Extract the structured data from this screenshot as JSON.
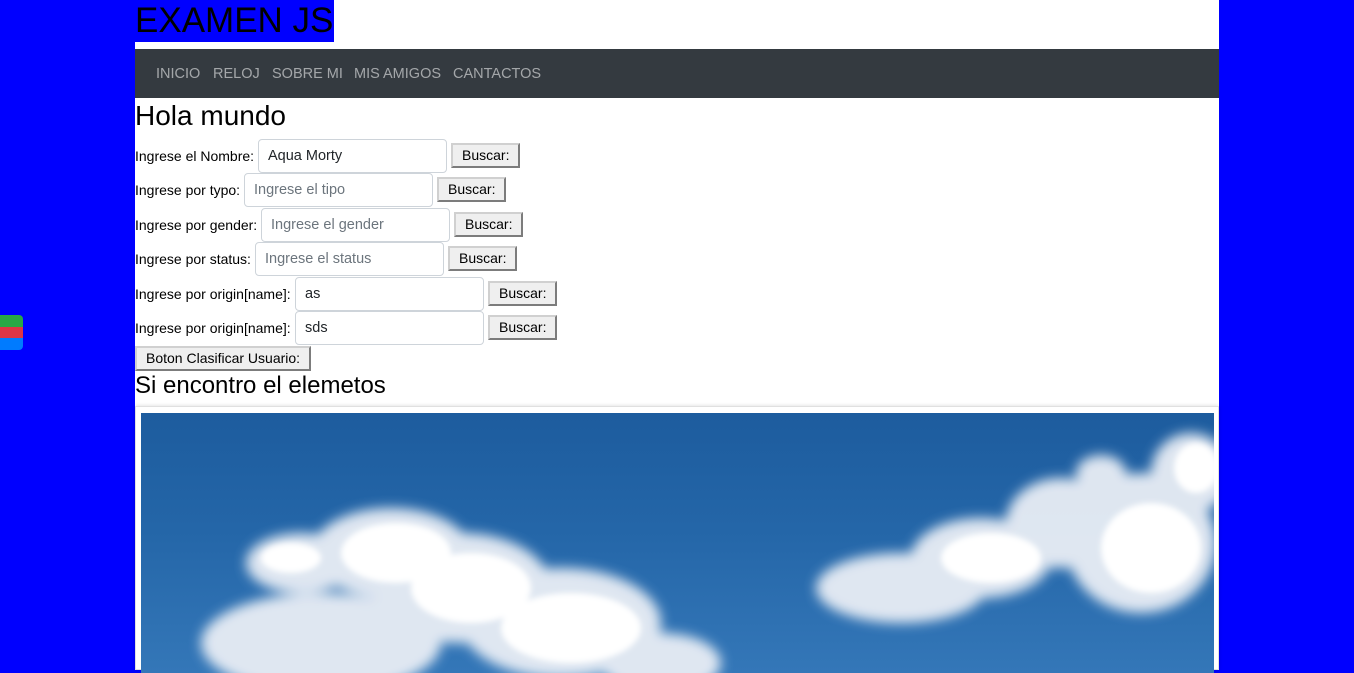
{
  "site": {
    "title": "EXAMEN JS"
  },
  "nav": {
    "items": [
      {
        "label": "INICIO"
      },
      {
        "label": "RELOJ"
      },
      {
        "label": "SOBRE MI"
      },
      {
        "label": "MIS AMIGOS"
      },
      {
        "label": "CANTACTOS"
      }
    ]
  },
  "main": {
    "heading": "Hola mundo",
    "result_heading": "Si encontro el elemetos",
    "classify_button": "Boton Clasificar Usuario:"
  },
  "search_rows": [
    {
      "label": "Ingrese el Nombre:",
      "value": "Aqua Morty",
      "placeholder": "",
      "button": "Buscar:"
    },
    {
      "label": "Ingrese por typo:",
      "value": "",
      "placeholder": "Ingrese el tipo",
      "button": "Buscar:"
    },
    {
      "label": "Ingrese por gender:",
      "value": "",
      "placeholder": "Ingrese el gender",
      "button": "Buscar:"
    },
    {
      "label": "Ingrese por status:",
      "value": "",
      "placeholder": "Ingrese el status",
      "button": "Buscar:"
    },
    {
      "label": "Ingrese por origin[name]:",
      "value": "as",
      "placeholder": "",
      "button": "Buscar:"
    },
    {
      "label": "Ingrese por origin[name]:",
      "value": "sds",
      "placeholder": "",
      "button": "Buscar:"
    }
  ],
  "image": {
    "icon": "sky-clouds-image"
  },
  "colors": {
    "background": "#0000ff",
    "navbar": "#343a40",
    "widget_stripes": [
      "#28a745",
      "#dc3545",
      "#007bff"
    ]
  }
}
